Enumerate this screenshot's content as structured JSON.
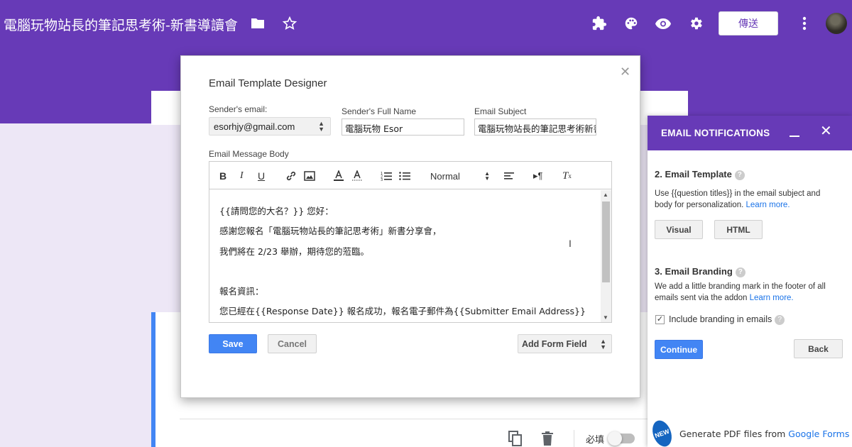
{
  "app": {
    "doc_title": "電腦玩物站長的筆記思考術-新書導讀會",
    "send_label": "傳送",
    "required_label": "必填"
  },
  "modal": {
    "title": "Email Template Designer",
    "sender_email_label": "Sender's email:",
    "sender_email_value": "esorhjy@gmail.com",
    "sender_name_label": "Sender's Full Name",
    "sender_name_value": "電腦玩物 Esor",
    "subject_label": "Email Subject",
    "subject_value": "電腦玩物站長的筆記思考術新書",
    "body_label": "Email Message Body",
    "format_select": "Normal",
    "body_lines": [
      "{{請問您的大名？}} 您好：",
      "感謝您報名「電腦玩物站長的筆記思考術」新書分享會，",
      "我們將在 2/23 舉辦，期待您的蒞臨。",
      "",
      "報名資訊：",
      "您已經在{{Response Date}} 報名成功，報名電子郵件為{{Submitter Email Address}}"
    ],
    "save_label": "Save",
    "cancel_label": "Cancel",
    "add_field_label": "Add Form Field"
  },
  "panel": {
    "title": "EMAIL NOTIFICATIONS",
    "template_heading": "2. Email Template",
    "template_text": "Use {{question titles}} in the email subject and body for personalization.",
    "learn_more": "Learn more.",
    "visual_label": "Visual",
    "html_label": "HTML",
    "branding_heading": "3. Email Branding",
    "branding_text": "We add a little branding mark in the footer of all emails sent via the addon",
    "branding_checkbox_label": "Include branding in emails",
    "branding_checked": true,
    "continue_label": "Continue",
    "back_label": "Back",
    "promo_badge": "NEW",
    "promo_text": "Generate PDF files from",
    "promo_link": "Google Forms"
  },
  "colors": {
    "brand": "#673ab7",
    "primary_button": "#4285f4",
    "link": "#1a73e8"
  }
}
